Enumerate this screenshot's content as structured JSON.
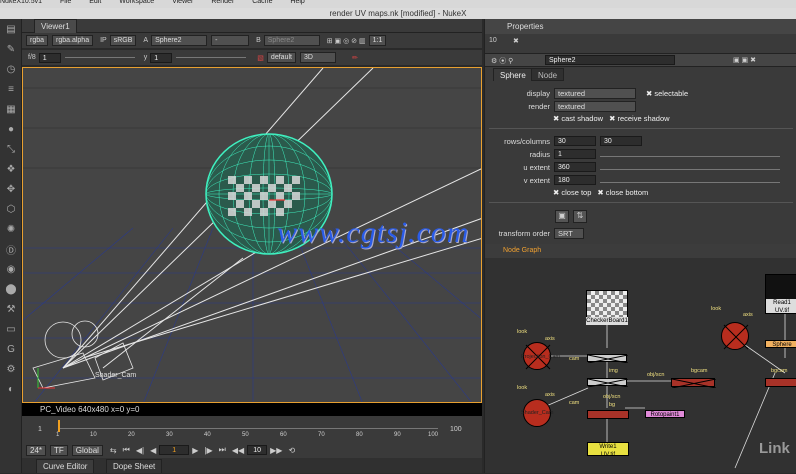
{
  "menubar": {
    "items": [
      "NukeX10.5v1",
      "File",
      "Edit",
      "Workspace",
      "Viewer",
      "Render",
      "Cache",
      "Help"
    ]
  },
  "window": {
    "title": "render UV maps.nk [modified] - NukeX"
  },
  "viewer": {
    "tab_label": "Viewer1",
    "channels": "rgba",
    "channel_alpha": "rgba.alpha",
    "ip": "IP",
    "colorspace": "sRGB",
    "input_a_label": "A",
    "input_a": "Sphere2",
    "input_a_op": "-",
    "input_b_label": "B",
    "input_b": "Sphere2",
    "ratio": "1:1",
    "fstop": "f/8",
    "gain": "1",
    "gamma_label": "y",
    "gamma": "1",
    "lut": "default",
    "view_mode": "3D",
    "camera_label": "Shader_Cam",
    "format": "PC_Video 640x480  x=0 y=0"
  },
  "timeline": {
    "start": "1",
    "end": "100",
    "ticks": [
      "1",
      "10",
      "20",
      "30",
      "40",
      "50",
      "60",
      "70",
      "80",
      "90",
      "100"
    ],
    "current_frame": "1"
  },
  "playback": {
    "fps": "24*",
    "tf": "TF",
    "scope": "Global",
    "frame": "1",
    "step": "10"
  },
  "bottom_tabs": [
    "Curve Editor",
    "Dope Sheet"
  ],
  "properties": {
    "panel_title": "Properties",
    "max_panels": "10",
    "node_name": "Sphere2",
    "tabs": [
      "Sphere",
      "Node"
    ],
    "display_label": "display",
    "display_value": "textured",
    "selectable": "selectable",
    "render_label": "render",
    "render_value": "textured",
    "cast_shadow": "cast shadow",
    "receive_shadow": "receive shadow",
    "rows_label": "rows/columns",
    "rows": "30",
    "columns": "30",
    "radius_label": "radius",
    "radius": "1",
    "u_extent_label": "u extent",
    "u_extent": "360",
    "v_extent_label": "v extent",
    "v_extent": "180",
    "close_top": "close top",
    "close_bottom": "close bottom",
    "transform_order_label": "transform order",
    "transform_order": "SRT"
  },
  "nodegraph": {
    "title": "Node Graph",
    "nodes": {
      "checkerboard": "CheckerBoard1",
      "projection_cam": "Projection_Cam",
      "shader_cam": "Shader_Cam",
      "write": "Write1",
      "write_sub": "UV.tif",
      "rotopaint": "Rotopaint1",
      "read": "Read1",
      "read_sub": "UV.tif",
      "sphere": "Sphere",
      "cam": "cam",
      "img": "img",
      "look": "look",
      "axis": "axis",
      "obj_scn": "obj/scn",
      "bg": "bg",
      "bgcam": "bgcam"
    }
  },
  "watermark": "www.cgtsj.com",
  "brand": "Link"
}
